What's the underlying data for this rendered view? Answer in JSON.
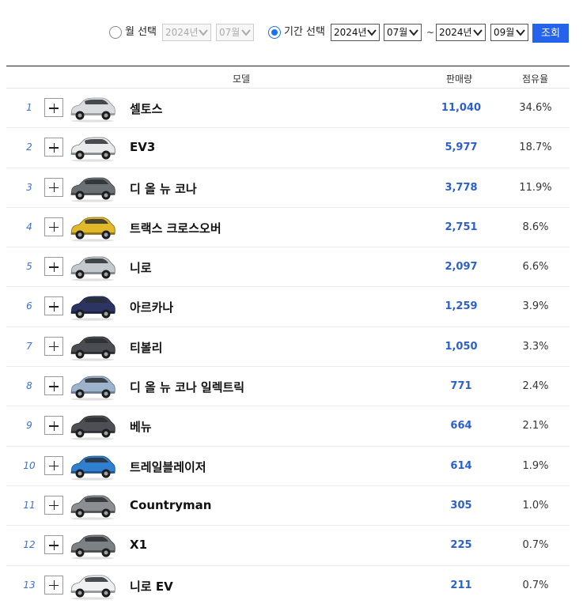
{
  "filter": {
    "month_label": "월 선택",
    "month_year": "2024년",
    "month_month": "07월",
    "period_label": "기간 선택",
    "from_year": "2024년",
    "from_month": "07월",
    "tilde": "~",
    "to_year": "2024년",
    "to_month": "09월",
    "search_label": "조회"
  },
  "columns": {
    "model": "모델",
    "sales": "판매량",
    "share": "점유율"
  },
  "rows": [
    {
      "rank": "1",
      "model": "셀토스",
      "sales": "11,040",
      "share": "34.6%",
      "color": "#d9dcdf",
      "dark": "#8a9096"
    },
    {
      "rank": "2",
      "model": "EV3",
      "sales": "5,977",
      "share": "18.7%",
      "color": "#e8eaec",
      "dark": "#6c7379"
    },
    {
      "rank": "3",
      "model": "디 올 뉴 코나",
      "sales": "3,778",
      "share": "11.9%",
      "color": "#6b7075",
      "dark": "#3b3f43"
    },
    {
      "rank": "4",
      "model": "트랙스 크로스오버",
      "sales": "2,751",
      "share": "8.6%",
      "color": "#e2b82b",
      "dark": "#7a6215"
    },
    {
      "rank": "5",
      "model": "니로",
      "sales": "2,097",
      "share": "6.6%",
      "color": "#c3c9cc",
      "dark": "#6e767b"
    },
    {
      "rank": "6",
      "model": "아르카나",
      "sales": "1,259",
      "share": "3.9%",
      "color": "#2c3463",
      "dark": "#141936"
    },
    {
      "rank": "7",
      "model": "티볼리",
      "sales": "1,050",
      "share": "3.3%",
      "color": "#4a4d52",
      "dark": "#222427"
    },
    {
      "rank": "8",
      "model": "디 올 뉴 코나 일렉트릭",
      "sales": "771",
      "share": "2.4%",
      "color": "#9db3cc",
      "dark": "#5c718a"
    },
    {
      "rank": "9",
      "model": "베뉴",
      "sales": "664",
      "share": "2.1%",
      "color": "#4d4f55",
      "dark": "#25272b"
    },
    {
      "rank": "10",
      "model": "트레일블레이저",
      "sales": "614",
      "share": "1.9%",
      "color": "#2e7fd0",
      "dark": "#17477a"
    },
    {
      "rank": "11",
      "model": "Countryman",
      "sales": "305",
      "share": "1.0%",
      "color": "#8c8f91",
      "dark": "#3f4244"
    },
    {
      "rank": "12",
      "model": "X1",
      "sales": "225",
      "share": "0.7%",
      "color": "#7c8184",
      "dark": "#3a3e41"
    },
    {
      "rank": "13",
      "model": "니로 EV",
      "sales": "211",
      "share": "0.7%",
      "color": "#eef0f1",
      "dark": "#7b8287"
    }
  ]
}
